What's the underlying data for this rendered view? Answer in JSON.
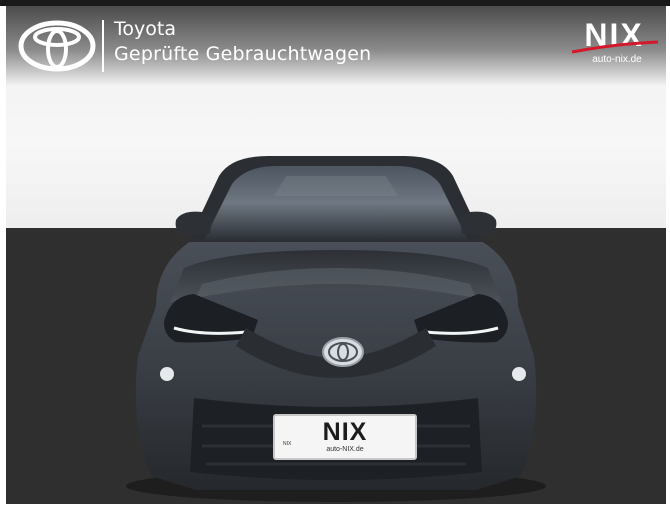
{
  "header": {
    "brand": "Toyota",
    "tagline": "Geprüfte Gebrauchtwagen",
    "dealer_logo_text": "NIX",
    "dealer_url": "auto-nix.de"
  },
  "license_plate": {
    "text": "NIX",
    "url": "auto-NIX.de",
    "small": "NIX"
  },
  "icons": {
    "brand_logo": "toyota-logo-icon",
    "dealer_logo": "nix-logo-icon"
  },
  "colors": {
    "header_text": "#ffffff",
    "nix_red": "#d2182a",
    "car_body": "#3b4148",
    "floor": "#2f2f2f"
  }
}
